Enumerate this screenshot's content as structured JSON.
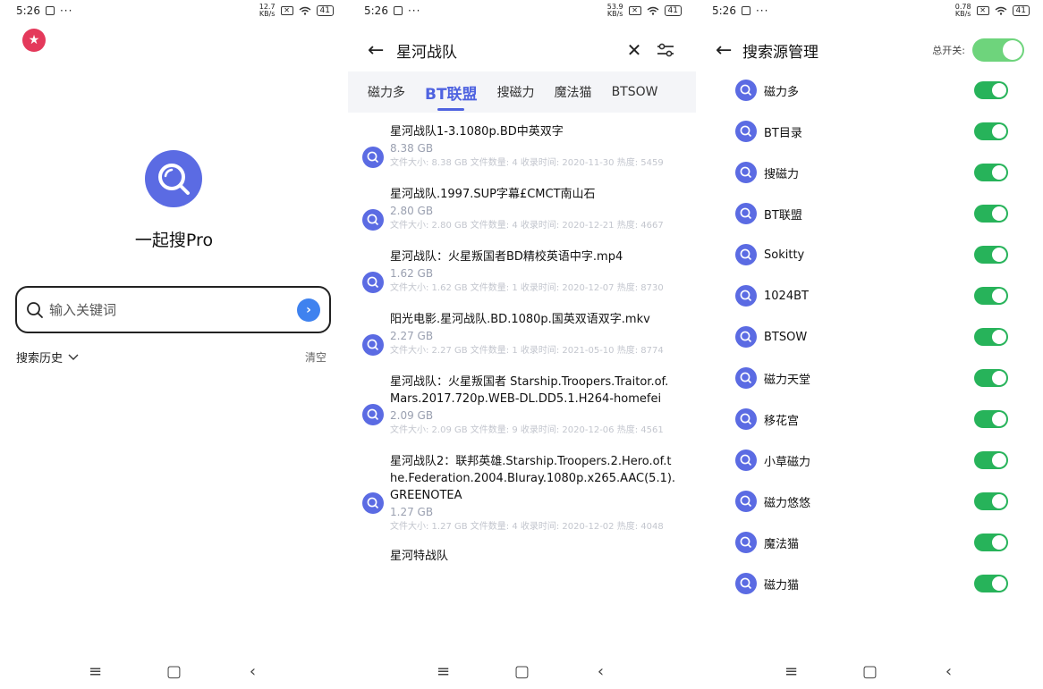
{
  "status_bars": [
    {
      "time": "5:26",
      "net": "12.7\nKB/s",
      "battery": "41"
    },
    {
      "time": "5:26",
      "net": "53.9\nKB/s",
      "battery": "41"
    },
    {
      "time": "5:26",
      "net": "0.78\nKB/s",
      "battery": "41"
    }
  ],
  "home": {
    "app_name": "一起搜Pro",
    "search_placeholder": "输入关键词",
    "history_label": "搜索历史",
    "clear_label": "清空"
  },
  "results_screen": {
    "query": "星河战队",
    "tabs": [
      {
        "label": "磁力多",
        "active": false
      },
      {
        "label": "BT联盟",
        "active": true
      },
      {
        "label": "搜磁力",
        "active": false
      },
      {
        "label": "魔法猫",
        "active": false
      },
      {
        "label": "BTSOW",
        "active": false
      }
    ],
    "results": [
      {
        "title": "星河战队1-3.1080p.BD中英双字",
        "size": "8.38 GB",
        "meta": "文件大小: 8.38 GB   文件数量: 4   收录时间: 2020-11-30   热度: 5459"
      },
      {
        "title": "星河战队.1997.SUP字幕£CMCT南山石",
        "size": "2.80 GB",
        "meta": "文件大小: 2.80 GB   文件数量: 4   收录时间: 2020-12-21   热度: 4667"
      },
      {
        "title": "星河战队：火星叛国者BD精校英语中字.mp4",
        "size": "1.62 GB",
        "meta": "文件大小: 1.62 GB   文件数量: 1   收录时间: 2020-12-07   热度: 8730"
      },
      {
        "title": "阳光电影.星河战队.BD.1080p.国英双语双字.mkv",
        "size": "2.27 GB",
        "meta": "文件大小: 2.27 GB   文件数量: 1   收录时间: 2021-05-10   热度: 8774"
      },
      {
        "title": "星河战队：火星叛国者 Starship.Troopers.Traitor.of.Mars.2017.720p.WEB-DL.DD5.1.H264-homefei",
        "size": "2.09 GB",
        "meta": "文件大小: 2.09 GB   文件数量: 9   收录时间: 2020-12-06   热度: 4561"
      },
      {
        "title": "星河战队2：联邦英雄.Starship.Troopers.2.Hero.of.the.Federation.2004.Bluray.1080p.x265.AAC(5.1).GREENOTEA",
        "size": "1.27 GB",
        "meta": "文件大小: 1.27 GB   文件数量: 4   收录时间: 2020-12-02   热度: 4048"
      },
      {
        "title": "星河特战队",
        "size": "",
        "meta": ""
      }
    ]
  },
  "sources_screen": {
    "title": "搜索源管理",
    "master_label": "总开关:",
    "master_on": true,
    "sources": [
      {
        "name": "磁力多",
        "on": true
      },
      {
        "name": "BT目录",
        "on": true
      },
      {
        "name": "搜磁力",
        "on": true
      },
      {
        "name": "BT联盟",
        "on": true
      },
      {
        "name": "Sokitty",
        "on": true
      },
      {
        "name": "1024BT",
        "on": true
      },
      {
        "name": "BTSOW",
        "on": true
      },
      {
        "name": "磁力天堂",
        "on": true
      },
      {
        "name": "移花宫",
        "on": true
      },
      {
        "name": "小草磁力",
        "on": true
      },
      {
        "name": "磁力悠悠",
        "on": true
      },
      {
        "name": "魔法猫",
        "on": true
      },
      {
        "name": "磁力猫",
        "on": true
      }
    ]
  },
  "colors": {
    "accent": "#5b6be3",
    "toggle_on": "#27b35a",
    "fav": "#e4395b",
    "go": "#3f82ef"
  }
}
